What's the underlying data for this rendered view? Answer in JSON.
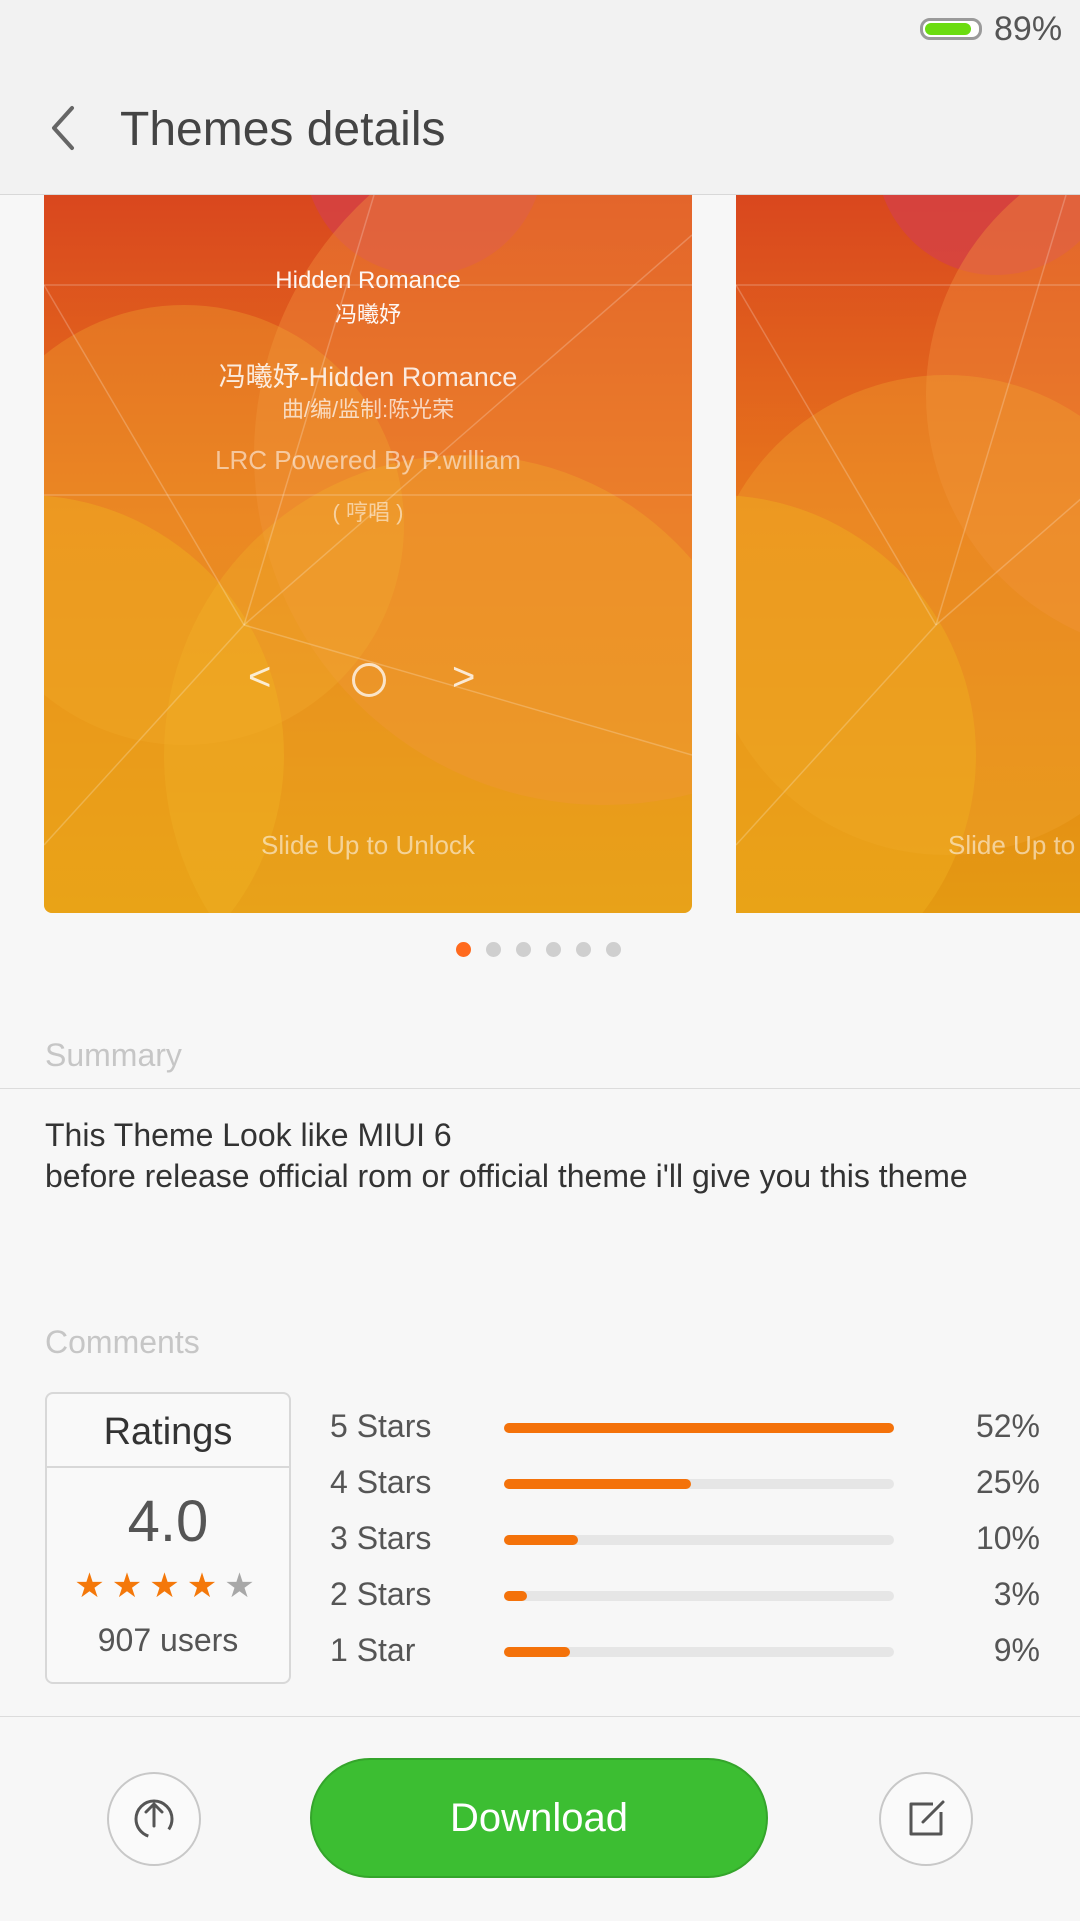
{
  "status_bar": {
    "battery_percent_text": "89%",
    "battery_level": 0.89,
    "battery_color": "#6bdc10"
  },
  "header": {
    "back_icon": "chevron-left-icon",
    "title": "Themes details"
  },
  "preview": {
    "slides": [
      {
        "song_title": "Hidden Romance",
        "artist": "冯曦妤",
        "lyric_line_1": "冯曦妤-Hidden Romance",
        "lyric_line_2": "曲/编/监制:陈光荣",
        "lrc_credit": "LRC Powered By P.william",
        "humming": "( 哼唱 )",
        "prev_icon": "<",
        "play_icon": "circle-play-icon",
        "next_icon": ">",
        "unlock_hint": "Slide Up to Unlock"
      },
      {
        "unlock_hint": "Slide Up to"
      }
    ],
    "page_count": 6,
    "active_page": 1,
    "accent_color": "#ff6a1e"
  },
  "summary": {
    "label": "Summary",
    "text_line_1": "This Theme Look like MIUI 6",
    "text_line_2": "before release official rom or official theme i'll give you this theme"
  },
  "comments": {
    "label": "Comments",
    "ratings": {
      "title": "Ratings",
      "score": "4.0",
      "stars_filled": 4,
      "stars_total": 5,
      "users": "907 users"
    },
    "breakdown": [
      {
        "label": "5 Stars",
        "percent_text": "52%",
        "value": 1.0
      },
      {
        "label": "4 Stars",
        "percent_text": "25%",
        "value": 0.48
      },
      {
        "label": "3 Stars",
        "percent_text": "10%",
        "value": 0.19
      },
      {
        "label": "2 Stars",
        "percent_text": "3%",
        "value": 0.06
      },
      {
        "label": "1 Star",
        "percent_text": "9%",
        "value": 0.17
      }
    ],
    "bar_color": "#f4720a"
  },
  "actions": {
    "share_icon": "share-upload-icon",
    "download_label": "Download",
    "download_color": "#3cbe32",
    "edit_icon": "edit-icon"
  }
}
